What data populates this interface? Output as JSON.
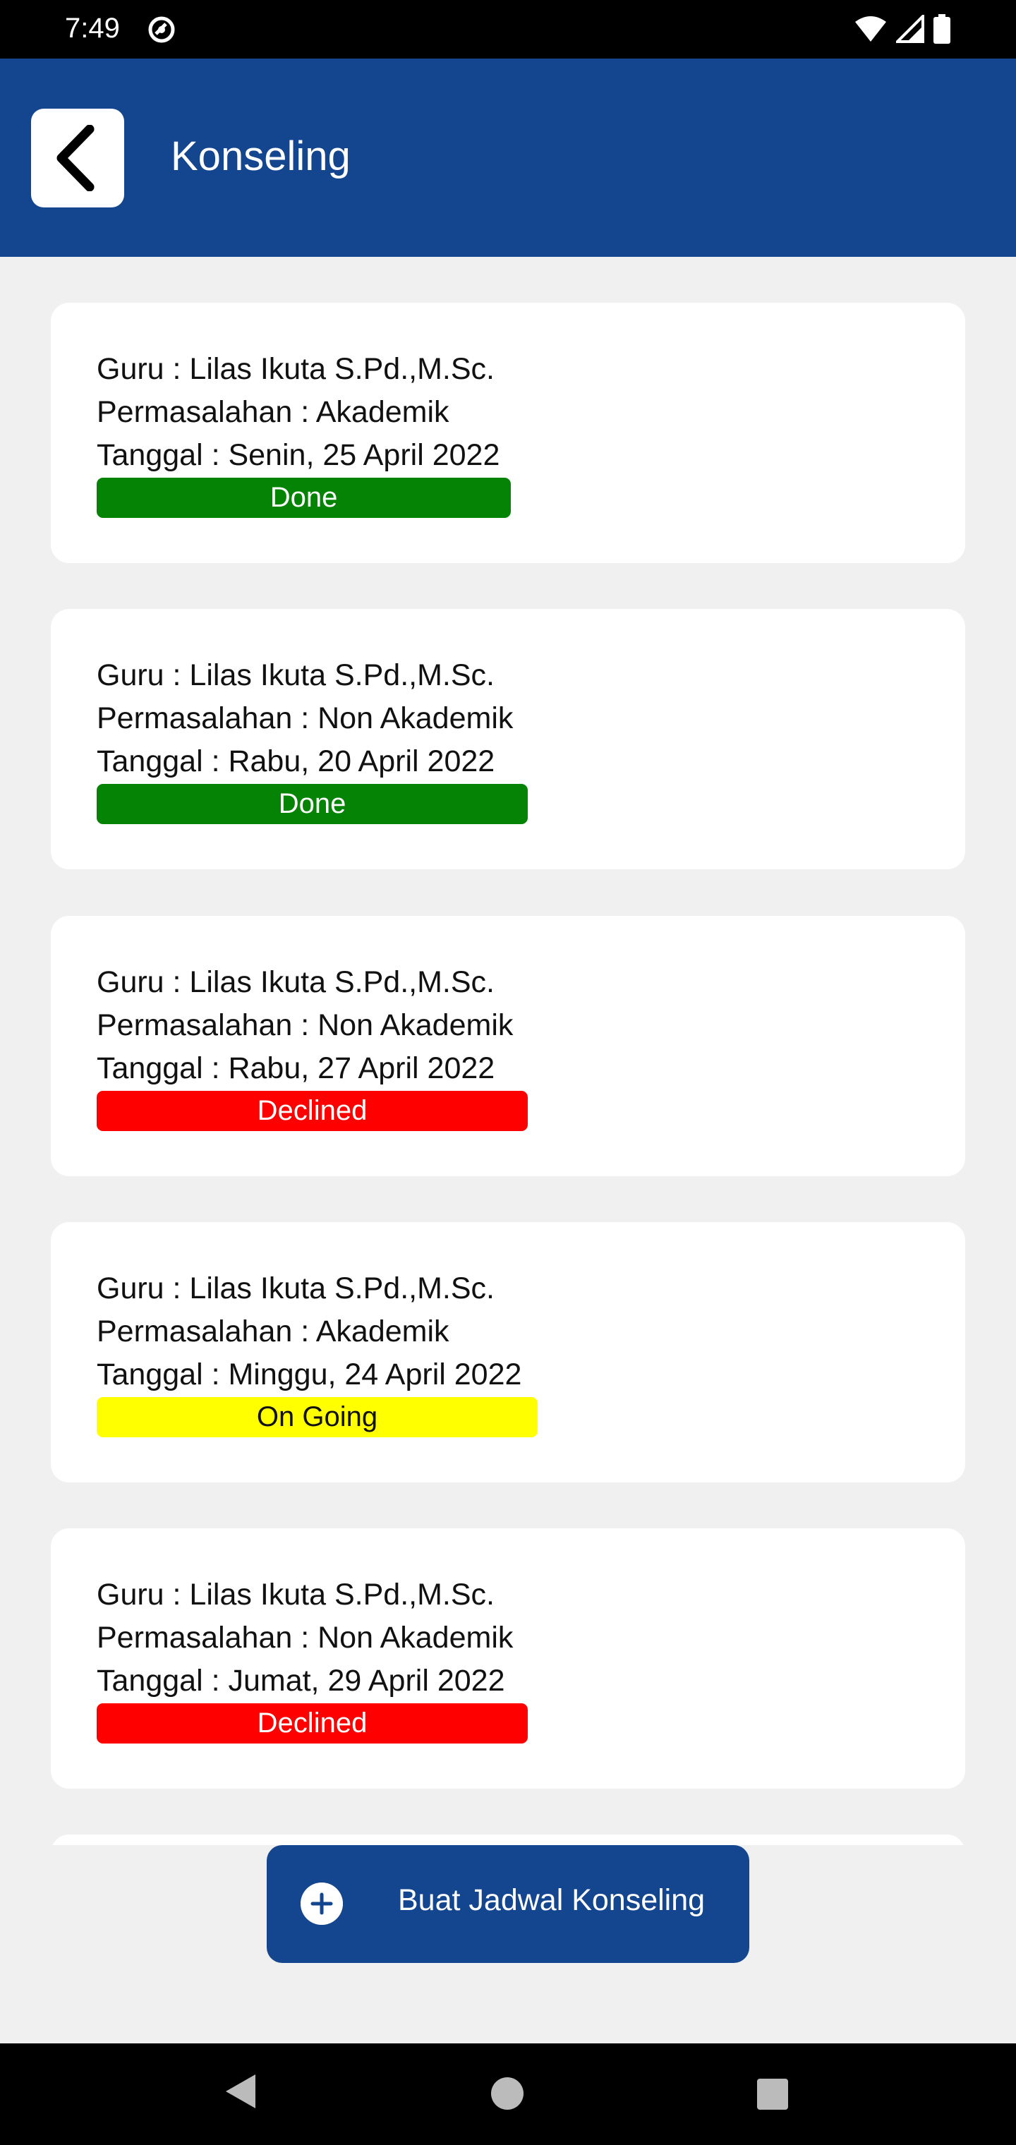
{
  "status_bar": {
    "time": "7:49",
    "icons": [
      "sync-icon",
      "wifi-icon",
      "signal-icon",
      "battery-icon"
    ]
  },
  "app_bar": {
    "back_icon": "chevron-left-icon",
    "title": "Konseling",
    "color": "#14468f"
  },
  "colors": {
    "done": "#048304",
    "declined": "#ff0000",
    "on_going": "#ffff00"
  },
  "cards": [
    {
      "guru": "Guru : Lilas Ikuta S.Pd.,M.Sc.",
      "masalah": "Permasalahan : Akademik",
      "tanggal": "Tanggal : Senin, 25 April 2022",
      "status": "Done"
    },
    {
      "guru": "Guru : Lilas Ikuta S.Pd.,M.Sc.",
      "masalah": "Permasalahan : Non Akademik",
      "tanggal": "Tanggal : Rabu, 20 April 2022",
      "status": "Done"
    },
    {
      "guru": "Guru : Lilas Ikuta S.Pd.,M.Sc.",
      "masalah": "Permasalahan : Non Akademik",
      "tanggal": "Tanggal : Rabu, 27 April 2022",
      "status": "Declined"
    },
    {
      "guru": "Guru : Lilas Ikuta S.Pd.,M.Sc.",
      "masalah": "Permasalahan : Akademik",
      "tanggal": "Tanggal : Minggu, 24 April 2022",
      "status": "On Going"
    },
    {
      "guru": "Guru : Lilas Ikuta S.Pd.,M.Sc.",
      "masalah": "Permasalahan : Non Akademik",
      "tanggal": "Tanggal : Jumat, 29 April 2022",
      "status": "Declined"
    }
  ],
  "fab": {
    "icon": "plus-circle-icon",
    "label": "Buat Jadwal Konseling"
  },
  "nav_bar": {
    "icons": [
      "nav-back-icon",
      "nav-home-icon",
      "nav-recents-icon"
    ]
  }
}
